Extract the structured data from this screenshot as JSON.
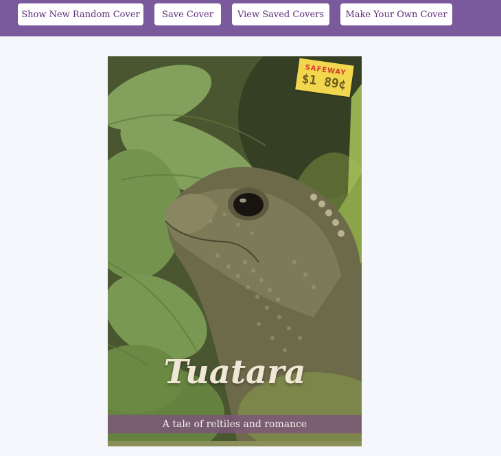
{
  "nav": {
    "buttons": [
      {
        "label": "Show New Random Cover"
      },
      {
        "label": "Save Cover"
      },
      {
        "label": "View Saved Covers"
      },
      {
        "label": "Make Your Own Cover"
      }
    ]
  },
  "cover": {
    "title": "Tuatara",
    "tagline": "A tale of reltiles and romance",
    "price_tag": {
      "store": "SAFEWAY",
      "price": "$1 89¢"
    }
  },
  "colors": {
    "nav_background": "#7a5a9c",
    "button_text": "#5e2a7a",
    "page_background": "#f6f7fc",
    "tagline_band": "#7d557d",
    "price_tag": "#f2d64d",
    "price_store_text": "#d23a2f"
  }
}
